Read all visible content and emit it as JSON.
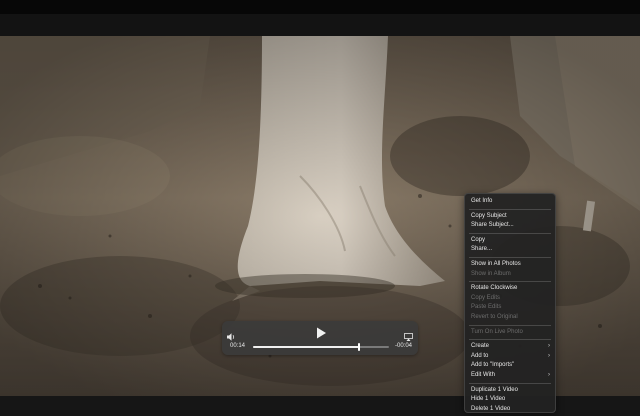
{
  "player": {
    "elapsed": "00:14",
    "remaining": "-00:04",
    "progress": 0.78,
    "icons": [
      "speaker-icon",
      "play-icon",
      "airplay-icon"
    ]
  },
  "menu": {
    "get_info": "Get Info",
    "copy_subject": "Copy Subject",
    "share_subject": "Share Subject...",
    "copy": "Copy",
    "share": "Share...",
    "show_in_all_photos": "Show in All Photos",
    "show_in_album": "Show in Album",
    "rotate_clockwise": "Rotate Clockwise",
    "copy_edits": "Copy Edits",
    "paste_edits": "Paste Edits",
    "revert_to_original": "Revert to Original",
    "turn_on_live_photo": "Turn On Live Photo",
    "create": "Create",
    "add_to": "Add to",
    "add_to_imports": "Add to \"Imports\"",
    "edit_with": "Edit With",
    "duplicate": "Duplicate 1 Video",
    "hide": "Hide 1 Video",
    "delete": "Delete 1 Video",
    "submenu_chevron": "›"
  },
  "colors": {
    "menu_bg": "#222222",
    "menu_text": "#e8e8e8",
    "menu_disabled": "#6c6c6c",
    "player_bg": "#3a3a3a"
  }
}
